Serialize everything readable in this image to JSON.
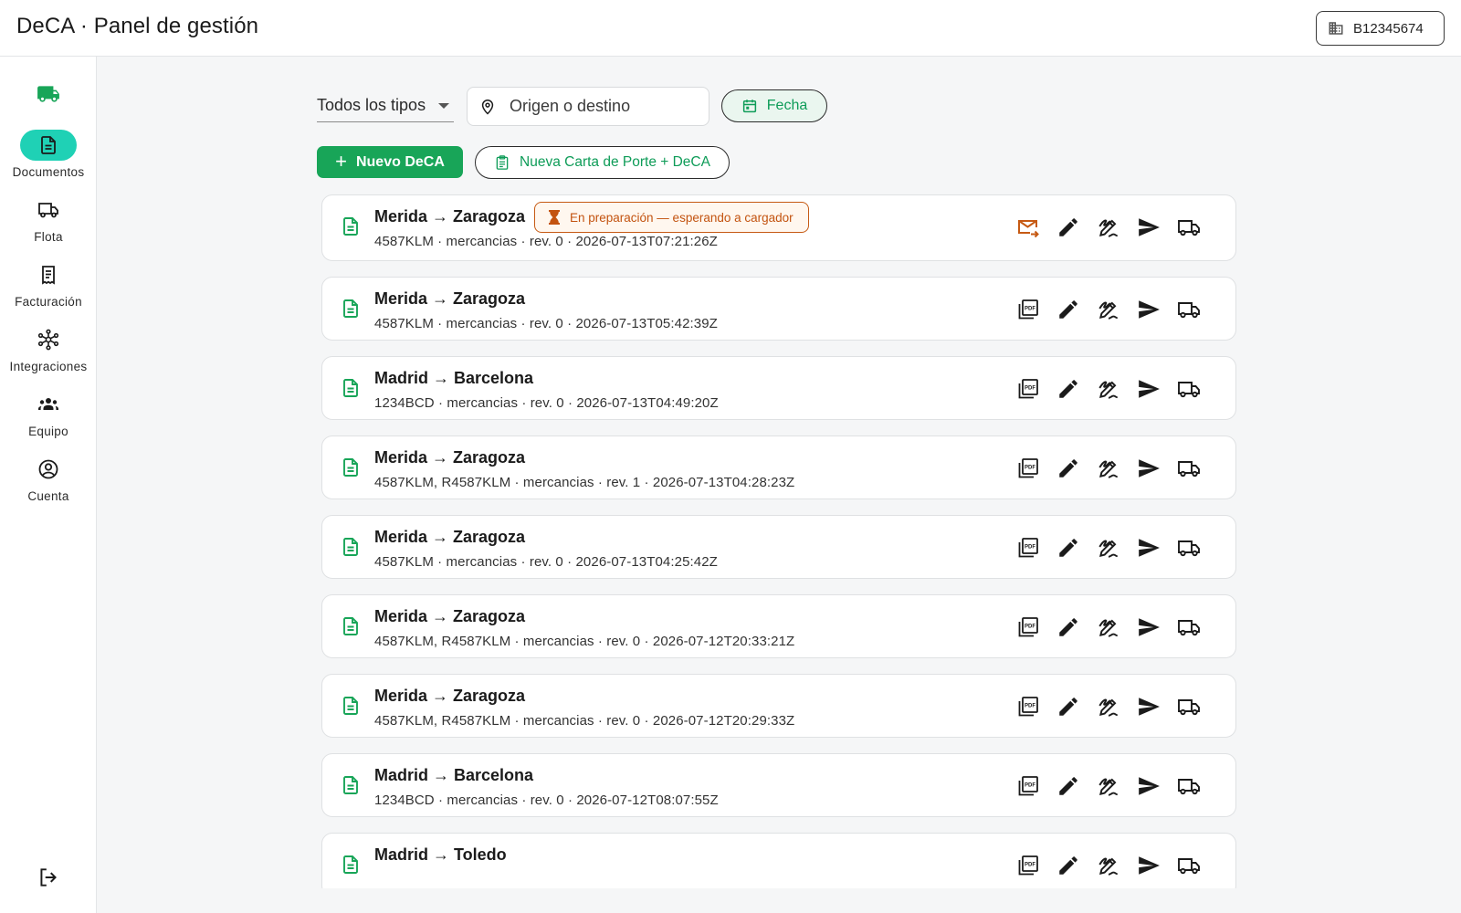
{
  "app": {
    "title": "DeCA · Panel de gestión",
    "company_id": "B12345674"
  },
  "sidebar": {
    "items": [
      {
        "label": "Documentos",
        "icon": "document-icon",
        "active": true
      },
      {
        "label": "Flota",
        "icon": "truck-icon",
        "active": false
      },
      {
        "label": "Facturación",
        "icon": "invoice-icon",
        "active": false
      },
      {
        "label": "Integraciones",
        "icon": "integrations-icon",
        "active": false
      },
      {
        "label": "Equipo",
        "icon": "team-icon",
        "active": false
      },
      {
        "label": "Cuenta",
        "icon": "account-icon",
        "active": false
      }
    ]
  },
  "filters": {
    "type_select": "Todos los tipos",
    "search_placeholder": "Origen o destino",
    "date_label": "Fecha"
  },
  "actions": {
    "new_deca": "Nuevo DeCA",
    "new_carta_porte": "Nueva Carta de Porte + DeCA"
  },
  "documents": [
    {
      "route": "Merida → Zaragoza",
      "meta": "4587KLM · mercancias · rev. 0 · 2026-07-13T07:21:26Z",
      "status": "En preparación — esperando a cargador",
      "first_action": "mail-forward-icon"
    },
    {
      "route": "Merida → Zaragoza",
      "meta": "4587KLM · mercancias · rev. 0 · 2026-07-13T05:42:39Z",
      "status": "",
      "first_action": "pdf-icon"
    },
    {
      "route": "Madrid → Barcelona",
      "meta": "1234BCD · mercancias · rev. 0 · 2026-07-13T04:49:20Z",
      "status": "",
      "first_action": "pdf-icon"
    },
    {
      "route": "Merida → Zaragoza",
      "meta": "4587KLM, R4587KLM · mercancias · rev. 1 · 2026-07-13T04:28:23Z",
      "status": "",
      "first_action": "pdf-icon"
    },
    {
      "route": "Merida → Zaragoza",
      "meta": "4587KLM · mercancias · rev. 0 · 2026-07-13T04:25:42Z",
      "status": "",
      "first_action": "pdf-icon"
    },
    {
      "route": "Merida → Zaragoza",
      "meta": "4587KLM, R4587KLM · mercancias · rev. 0 · 2026-07-12T20:33:21Z",
      "status": "",
      "first_action": "pdf-icon"
    },
    {
      "route": "Merida → Zaragoza",
      "meta": "4587KLM, R4587KLM · mercancias · rev. 0 · 2026-07-12T20:29:33Z",
      "status": "",
      "first_action": "pdf-icon"
    },
    {
      "route": "Madrid → Barcelona",
      "meta": "1234BCD · mercancias · rev. 0 · 2026-07-12T08:07:55Z",
      "status": "",
      "first_action": "pdf-icon"
    },
    {
      "route": "Madrid → Toledo",
      "meta": "",
      "status": "",
      "first_action": "pdf-icon"
    }
  ],
  "colors": {
    "accent_green": "#18a558",
    "active_nav": "#1fd1b5",
    "status_orange": "#c65a14"
  }
}
